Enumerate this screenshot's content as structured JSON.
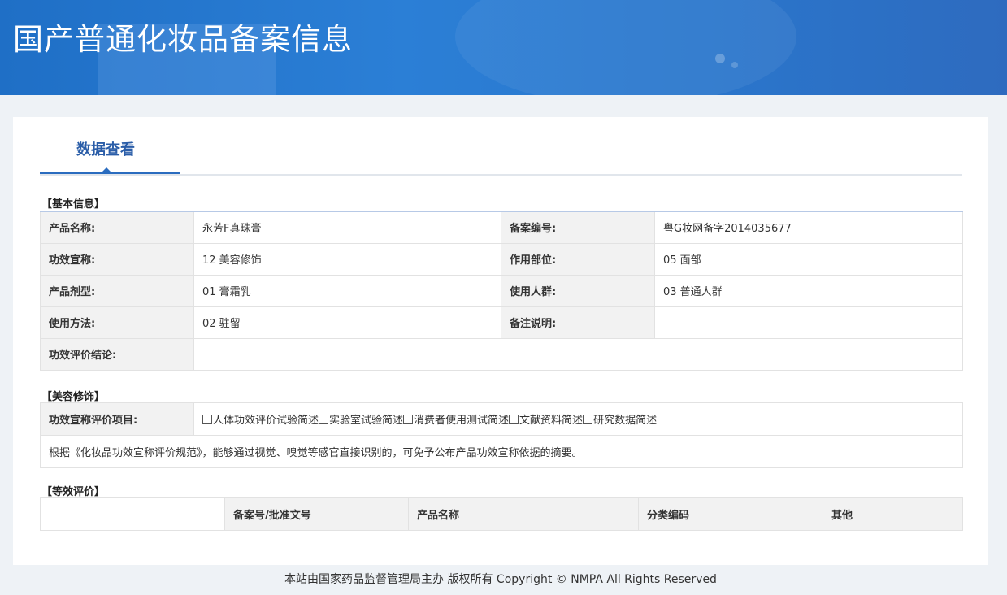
{
  "banner": {
    "title": "国产普通化妆品备案信息"
  },
  "tabs": {
    "active_label": "数据查看"
  },
  "basic": {
    "section_title": "【基本信息】",
    "rows": [
      {
        "label1": "产品名称:",
        "value1": "永芳F真珠膏",
        "label2": "备案编号:",
        "value2": "粤G妆网备字2014035677"
      },
      {
        "label1": "功效宣称:",
        "value1": "12 美容修饰",
        "label2": "作用部位:",
        "value2": "05 面部"
      },
      {
        "label1": "产品剂型:",
        "value1": "01 膏霜乳",
        "label2": "使用人群:",
        "value2": "03 普通人群"
      },
      {
        "label1": "使用方法:",
        "value1": "02 驻留",
        "label2": "备注说明:",
        "value2": ""
      }
    ],
    "conclusion_label": "功效评价结论:",
    "conclusion_value": ""
  },
  "beauty": {
    "section_title": "【美容修饰】",
    "items_label": "功效宣称评价项目:",
    "checkboxes": [
      "人体功效评价试验简述",
      "实验室试验简述",
      "消费者使用测试简述",
      "文献资料简述",
      "研究数据简述"
    ],
    "note": "根据《化妆品功效宣称评价规范》，能够通过视觉、嗅觉等感官直接识别的，可免予公布产品功效宣称依据的摘要。"
  },
  "equiv": {
    "section_title": "【等效评价】",
    "headers": [
      "",
      "备案号/批准文号",
      "产品名称",
      "分类编码",
      "其他"
    ]
  },
  "footer": {
    "text": "本站由国家药品监督管理局主办 版权所有 Copyright © NMPA All Rights Reserved"
  }
}
